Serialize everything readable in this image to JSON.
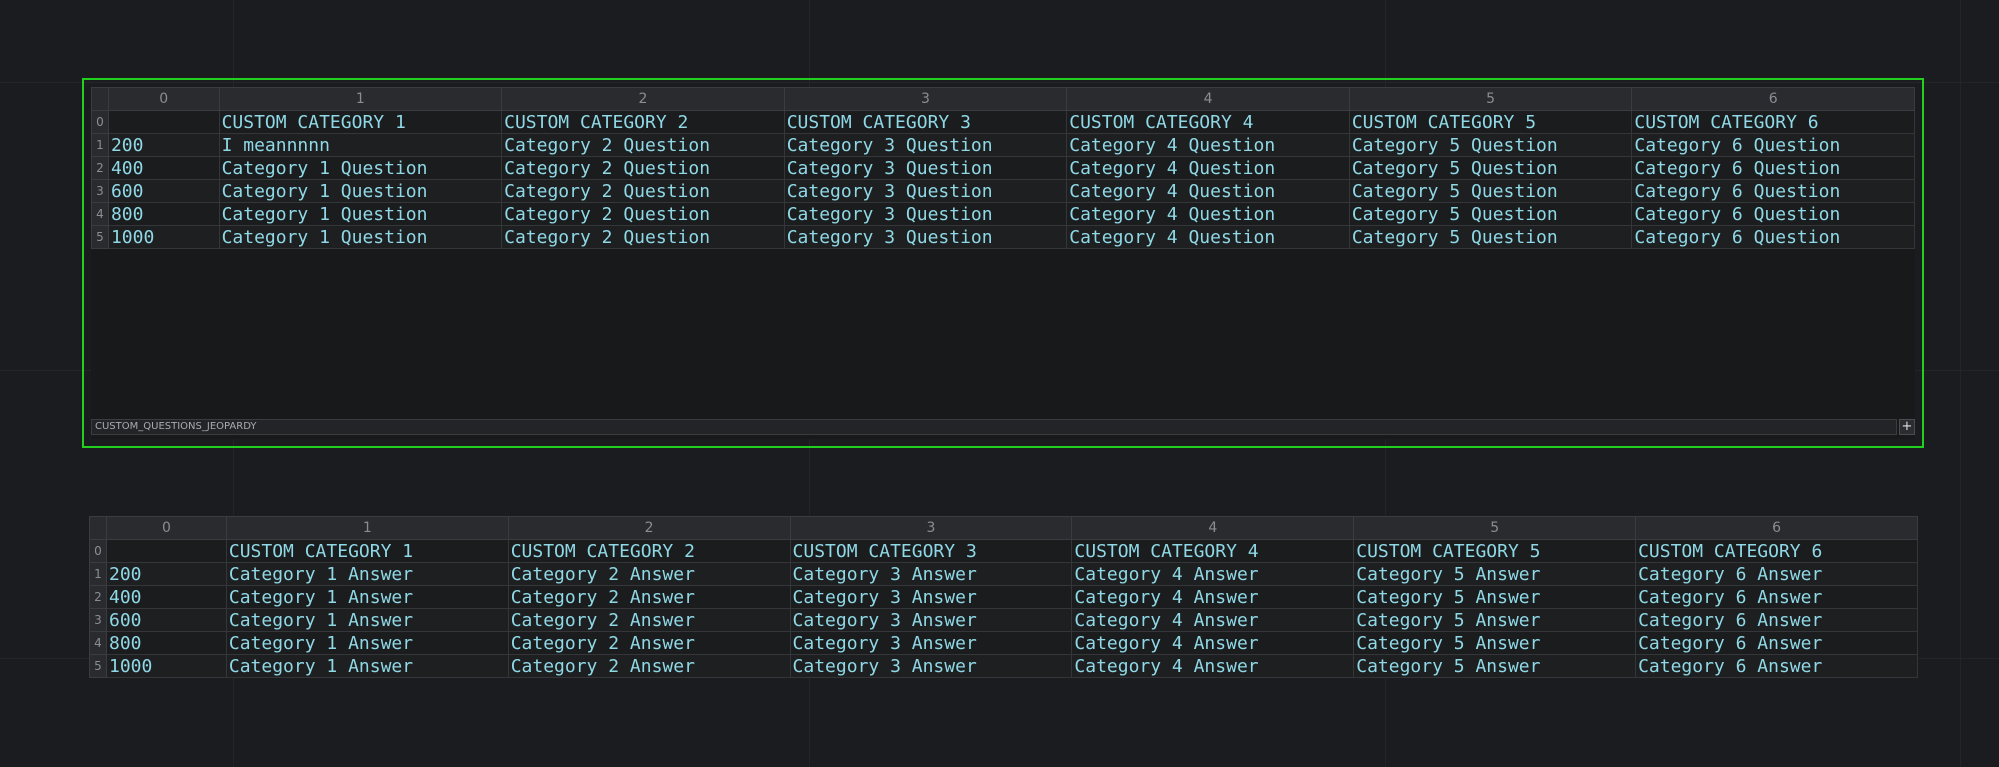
{
  "questions_table": {
    "name": "CUSTOM_QUESTIONS_JEOPARDY",
    "add_button": "+",
    "columns": [
      "0",
      "1",
      "2",
      "3",
      "4",
      "5",
      "6"
    ],
    "rows": [
      {
        "index": "0",
        "cells": [
          "",
          "CUSTOM CATEGORY 1",
          "CUSTOM CATEGORY 2",
          "CUSTOM CATEGORY 3",
          "CUSTOM CATEGORY 4",
          "CUSTOM CATEGORY 5",
          "CUSTOM CATEGORY 6"
        ]
      },
      {
        "index": "1",
        "cells": [
          "200",
          "I meannnnn",
          "Category 2 Question",
          "Category 3 Question",
          "Category 4 Question",
          "Category 5 Question",
          "Category 6 Question"
        ]
      },
      {
        "index": "2",
        "cells": [
          "400",
          "Category 1 Question",
          "Category 2 Question",
          "Category 3 Question",
          "Category 4 Question",
          "Category 5 Question",
          "Category 6 Question"
        ]
      },
      {
        "index": "3",
        "cells": [
          "600",
          "Category 1 Question",
          "Category 2 Question",
          "Category 3 Question",
          "Category 4 Question",
          "Category 5 Question",
          "Category 6 Question"
        ]
      },
      {
        "index": "4",
        "cells": [
          "800",
          "Category 1 Question",
          "Category 2 Question",
          "Category 3 Question",
          "Category 4 Question",
          "Category 5 Question",
          "Category 6 Question"
        ]
      },
      {
        "index": "5",
        "cells": [
          "1000",
          "Category 1 Question",
          "Category 2 Question",
          "Category 3 Question",
          "Category 4 Question",
          "Category 5 Question",
          "Category 6 Question"
        ]
      }
    ]
  },
  "answers_table": {
    "columns": [
      "0",
      "1",
      "2",
      "3",
      "4",
      "5",
      "6"
    ],
    "rows": [
      {
        "index": "0",
        "cells": [
          "",
          "CUSTOM CATEGORY 1",
          "CUSTOM CATEGORY 2",
          "CUSTOM CATEGORY 3",
          "CUSTOM CATEGORY 4",
          "CUSTOM CATEGORY 5",
          "CUSTOM CATEGORY 6"
        ]
      },
      {
        "index": "1",
        "cells": [
          "200",
          "Category 1 Answer",
          "Category 2 Answer",
          "Category 3 Answer",
          "Category 4 Answer",
          "Category 5 Answer",
          "Category 6 Answer"
        ]
      },
      {
        "index": "2",
        "cells": [
          "400",
          "Category 1 Answer",
          "Category 2 Answer",
          "Category 3 Answer",
          "Category 4 Answer",
          "Category 5 Answer",
          "Category 6 Answer"
        ]
      },
      {
        "index": "3",
        "cells": [
          "600",
          "Category 1 Answer",
          "Category 2 Answer",
          "Category 3 Answer",
          "Category 4 Answer",
          "Category 5 Answer",
          "Category 6 Answer"
        ]
      },
      {
        "index": "4",
        "cells": [
          "800",
          "Category 1 Answer",
          "Category 2 Answer",
          "Category 3 Answer",
          "Category 4 Answer",
          "Category 5 Answer",
          "Category 6 Answer"
        ]
      },
      {
        "index": "5",
        "cells": [
          "1000",
          "Category 1 Answer",
          "Category 2 Answer",
          "Category 3 Answer",
          "Category 4 Answer",
          "Category 5 Answer",
          "Category 6 Answer"
        ]
      }
    ]
  },
  "colors": {
    "selection_border": "#22d11e",
    "cell_text": "#8fd8e6",
    "background": "#1b1c1f"
  }
}
